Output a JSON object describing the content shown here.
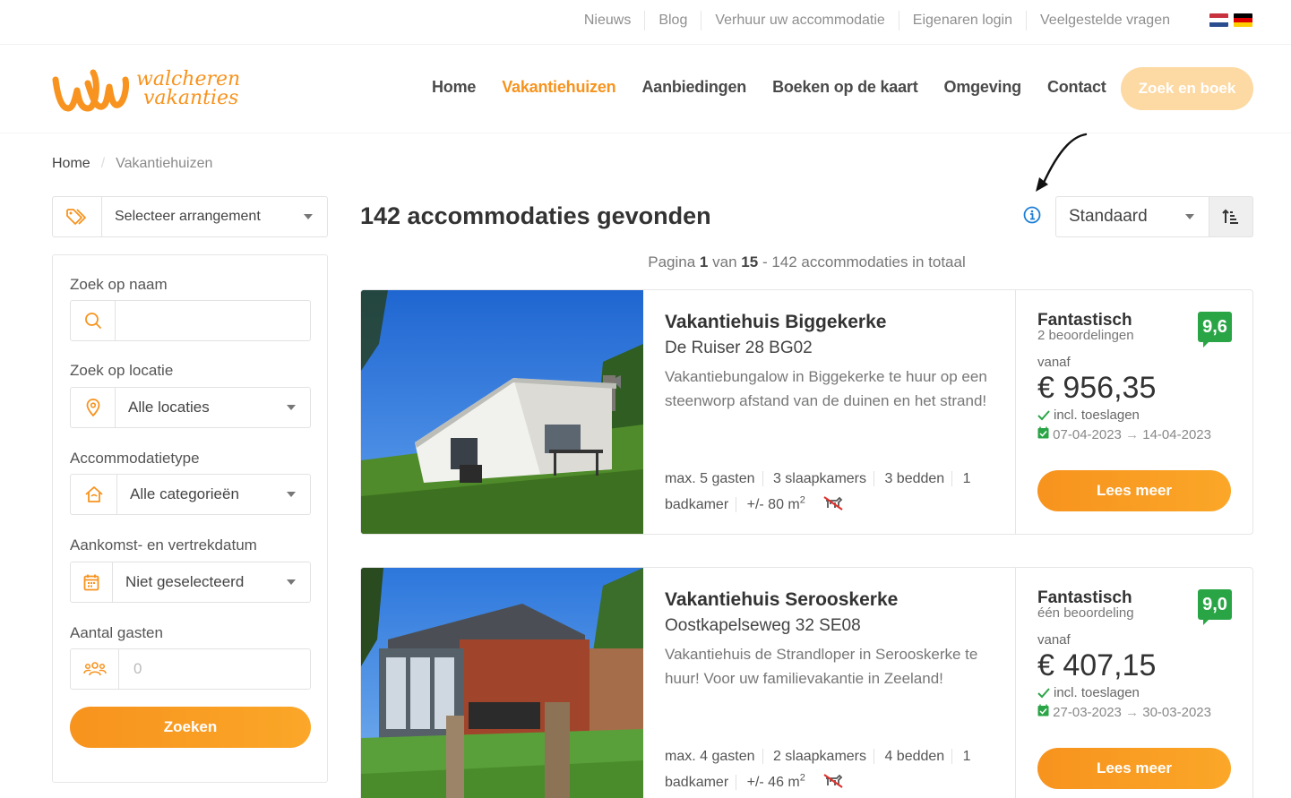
{
  "topbar": {
    "links": [
      "Nieuws",
      "Blog",
      "Verhuur uw accommodatie",
      "Eigenaren login",
      "Veelgestelde vragen"
    ]
  },
  "header": {
    "logo_line1": "walcheren",
    "logo_line2": "vakanties",
    "nav": [
      "Home",
      "Vakantiehuizen",
      "Aanbiedingen",
      "Boeken op de kaart",
      "Omgeving",
      "Contact"
    ],
    "active_nav": "Vakantiehuizen",
    "cta": "Zoek en boek"
  },
  "breadcrumb": {
    "home": "Home",
    "current": "Vakantiehuizen"
  },
  "sidebar": {
    "arrangement": "Selecteer arrangement",
    "name_label": "Zoek op naam",
    "name_value": "",
    "location_label": "Zoek op locatie",
    "location_value": "Alle locaties",
    "type_label": "Accommodatietype",
    "type_value": "Alle categorieën",
    "date_label": "Aankomst- en vertrekdatum",
    "date_value": "Niet geselecteerd",
    "guests_label": "Aantal gasten",
    "guests_placeholder": "0",
    "search_button": "Zoeken"
  },
  "results": {
    "title": "142 accommodaties gevonden",
    "sort_value": "Standaard",
    "page_prefix": "Pagina",
    "page_current": "1",
    "page_mid": "van",
    "page_total": "15",
    "page_suffix": "- 142 accommodaties in totaal"
  },
  "listings": [
    {
      "title": "Vakantiehuis Biggekerke",
      "address": "De Ruiser 28 BG02",
      "description": "Vakantiebungalow in Biggekerke te huur op een steenworp afstand van de duinen en het strand!",
      "features": [
        "max. 5 gasten",
        "3 slaapkamers",
        "3 bedden",
        "1 badkamer"
      ],
      "area": "+/- 80 m",
      "rating_word": "Fantastisch",
      "rating_count": "2 beoordelingen",
      "score": "9,6",
      "vanaf": "vanaf",
      "price": "€ 956,35",
      "incl": "incl. toeslagen",
      "date_from": "07-04-2023",
      "date_to": "14-04-2023",
      "button": "Lees meer"
    },
    {
      "title": "Vakantiehuis Serooskerke",
      "address": "Oostkapelseweg 32 SE08",
      "description": "Vakantiehuis de Strandloper in Serooskerke te huur! Voor uw familievakantie in Zeeland!",
      "features": [
        "max. 4 gasten",
        "2 slaapkamers",
        "4 bedden",
        "1 badkamer"
      ],
      "area": "+/- 46 m",
      "rating_word": "Fantastisch",
      "rating_count": "één beoordeling",
      "score": "9,0",
      "vanaf": "vanaf",
      "price": "€ 407,15",
      "incl": "incl. toeslagen",
      "date_from": "27-03-2023",
      "date_to": "30-03-2023",
      "button": "Lees meer"
    }
  ],
  "colors": {
    "accent": "#f7931e",
    "score": "#2aa546",
    "info": "#1e7fd6"
  }
}
